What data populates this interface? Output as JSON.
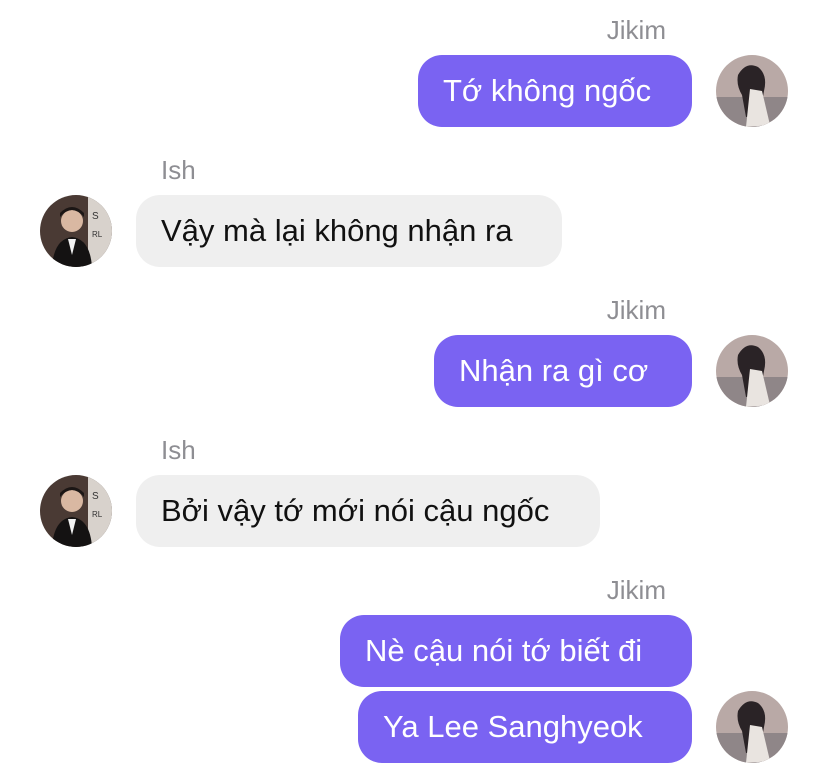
{
  "colors": {
    "outgoing_bubble": "#7a63f2",
    "incoming_bubble": "#efefef",
    "sender_name": "#8e8e93"
  },
  "messages": [
    {
      "sender": "Jikim",
      "direction": "outgoing",
      "avatar": "avatar-photo-girl",
      "text": "Tớ không ngốc"
    },
    {
      "sender": "Ish",
      "direction": "incoming",
      "avatar": "avatar-photo-man",
      "text": "Vậy mà lại không nhận ra"
    },
    {
      "sender": "Jikim",
      "direction": "outgoing",
      "avatar": "avatar-photo-girl",
      "text": "Nhận ra gì cơ"
    },
    {
      "sender": "Ish",
      "direction": "incoming",
      "avatar": "avatar-photo-man",
      "text": "Bởi vậy tớ mới nói cậu ngốc"
    },
    {
      "sender": "Jikim",
      "direction": "outgoing",
      "avatar": "avatar-photo-girl",
      "text": "Nè cậu nói tớ biết đi"
    },
    {
      "sender": "Jikim",
      "direction": "outgoing",
      "avatar": "avatar-photo-girl",
      "text": "Ya Lee Sanghyeok"
    }
  ]
}
